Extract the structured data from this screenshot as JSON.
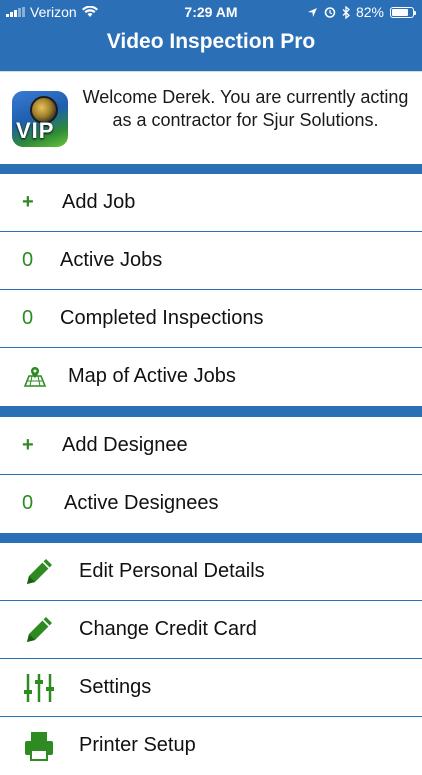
{
  "status_bar": {
    "carrier": "Verizon",
    "time": "7:29 AM",
    "battery": "82%",
    "battery_level": 0.82,
    "icons": [
      "signal-icon",
      "wifi-icon",
      "location-icon",
      "alarm-icon",
      "bluetooth-icon",
      "battery-icon"
    ]
  },
  "nav": {
    "title": "Video Inspection Pro"
  },
  "welcome": {
    "text": "Welcome Derek.  You are currently acting as a contractor for Sjur Solutions.",
    "icon_text": "VIP"
  },
  "jobs_group": [
    {
      "lead": "+",
      "label": "Add Job"
    },
    {
      "lead": "0",
      "label": "Active Jobs"
    },
    {
      "lead": "0",
      "label": "Completed Inspections"
    },
    {
      "lead": "map-icon",
      "label": "Map of Active Jobs"
    }
  ],
  "designee_group": [
    {
      "lead": "+",
      "label": "Add Designee"
    },
    {
      "lead": "0",
      "label": "Active Designees"
    }
  ],
  "settings_group": [
    {
      "lead": "pencil-icon",
      "label": "Edit Personal Details"
    },
    {
      "lead": "pencil-icon",
      "label": "Change Credit Card"
    },
    {
      "lead": "sliders-icon",
      "label": "Settings"
    },
    {
      "lead": "printer-icon",
      "label": "Printer Setup"
    }
  ],
  "colors": {
    "background": "#2b6fb7",
    "accent_green": "#2e8b22",
    "text": "#111111"
  }
}
